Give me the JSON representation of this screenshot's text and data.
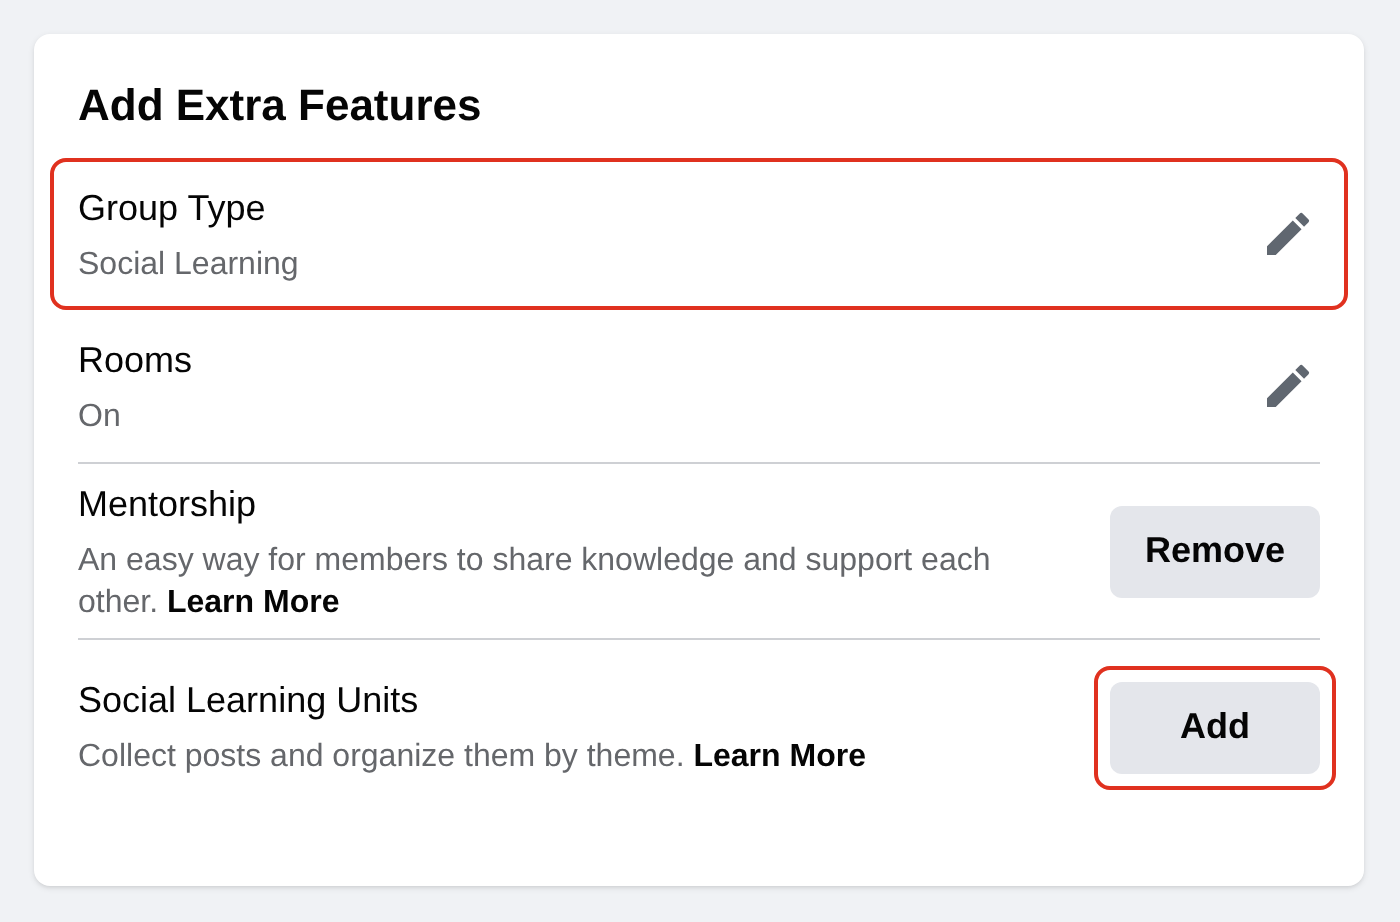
{
  "card": {
    "title": "Add Extra Features",
    "rows": [
      {
        "kind": "edit",
        "title": "Group Type",
        "subtitle": "Social Learning",
        "highlighted": true
      },
      {
        "kind": "edit",
        "title": "Rooms",
        "subtitle": "On",
        "highlighted": false
      },
      {
        "kind": "button",
        "title": "Mentorship",
        "subtitle": "An easy way for members to share knowledge and support each other. **Learn More**",
        "button": "Remove",
        "highlighted": false
      },
      {
        "kind": "button",
        "title": "Social Learning Units",
        "subtitle": "Collect posts and organize them by theme. **Learn More**",
        "button": "Add",
        "highlighted": true
      }
    ]
  }
}
